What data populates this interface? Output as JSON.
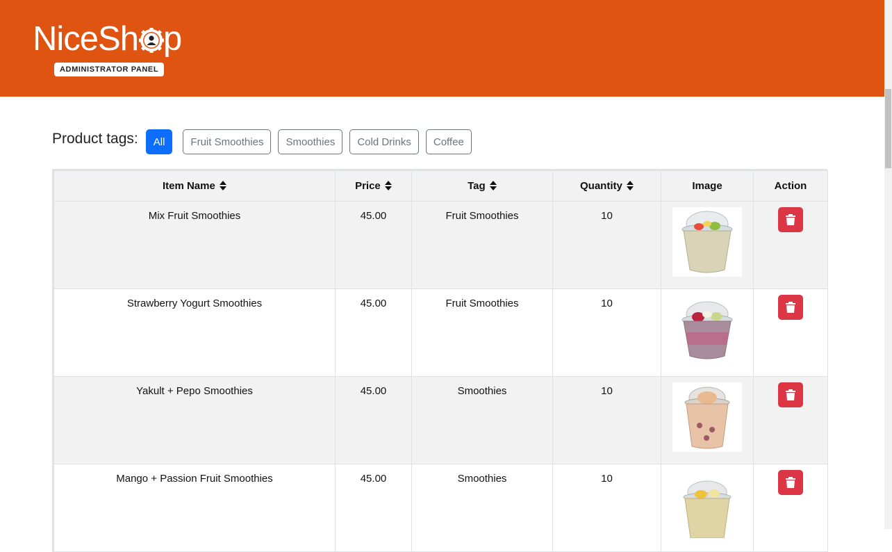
{
  "brand": {
    "name_prefix": "NiceSh",
    "name_suffix": "p",
    "badge": "ADMINISTRATOR PANEL",
    "header_color": "#e05412"
  },
  "tags": {
    "label": "Product tags:",
    "items": [
      {
        "label": "All",
        "active": true
      },
      {
        "label": "Fruit Smoothies",
        "active": false
      },
      {
        "label": "Smoothies",
        "active": false
      },
      {
        "label": "Cold Drinks",
        "active": false
      },
      {
        "label": "Coffee",
        "active": false
      }
    ]
  },
  "table": {
    "headers": {
      "item_name": "Item Name",
      "price": "Price",
      "tag": "Tag",
      "quantity": "Quantity",
      "image": "Image",
      "action": "Action"
    },
    "rows": [
      {
        "name": "Mix Fruit Smoothies",
        "price": "45.00",
        "tag": "Fruit Smoothies",
        "quantity": "10",
        "image": "smoothie-cup-mixed-fruit"
      },
      {
        "name": "Strawberry Yogurt Smoothies",
        "price": "45.00",
        "tag": "Fruit Smoothies",
        "quantity": "10",
        "image": "smoothie-cup-strawberry"
      },
      {
        "name": "Yakult + Pepo Smoothies",
        "price": "45.00",
        "tag": "Smoothies",
        "quantity": "10",
        "image": "smoothie-cup-yakult"
      },
      {
        "name": "Mango + Passion Fruit Smoothies",
        "price": "45.00",
        "tag": "Smoothies",
        "quantity": "10",
        "image": "smoothie-cup-mango"
      }
    ]
  },
  "colors": {
    "primary": "#0d6efd",
    "danger": "#dc3545",
    "secondary": "#6c757d"
  }
}
